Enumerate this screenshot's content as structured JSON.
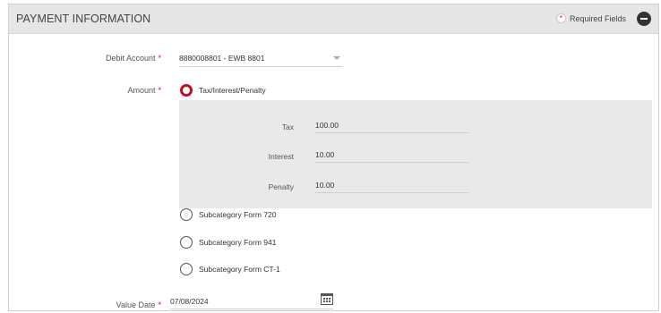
{
  "section": {
    "title": "PAYMENT INFORMATION",
    "required_legend": "Required Fields",
    "required_marker": "*"
  },
  "debit_account": {
    "label": "Debit Account",
    "value": "8880008801 - EWB 8801"
  },
  "amount": {
    "label": "Amount",
    "options": [
      {
        "label": "Tax/Interest/Penalty",
        "selected": true
      },
      {
        "label": "Subcategory Form 720",
        "selected": false
      },
      {
        "label": "Subcategory Form 941",
        "selected": false
      },
      {
        "label": "Subcategory Form CT-1",
        "selected": false
      }
    ],
    "breakdown": [
      {
        "label": "Tax",
        "value": "100.00"
      },
      {
        "label": "Interest",
        "value": "10.00"
      },
      {
        "label": "Penalty",
        "value": "10.00"
      }
    ]
  },
  "value_date": {
    "label": "Value Date",
    "value": "07/08/2024"
  },
  "colors": {
    "header_bg": "#e6e6e6",
    "accent_red": "#c40f1d",
    "breakdown_bg": "#e9e9e9"
  }
}
